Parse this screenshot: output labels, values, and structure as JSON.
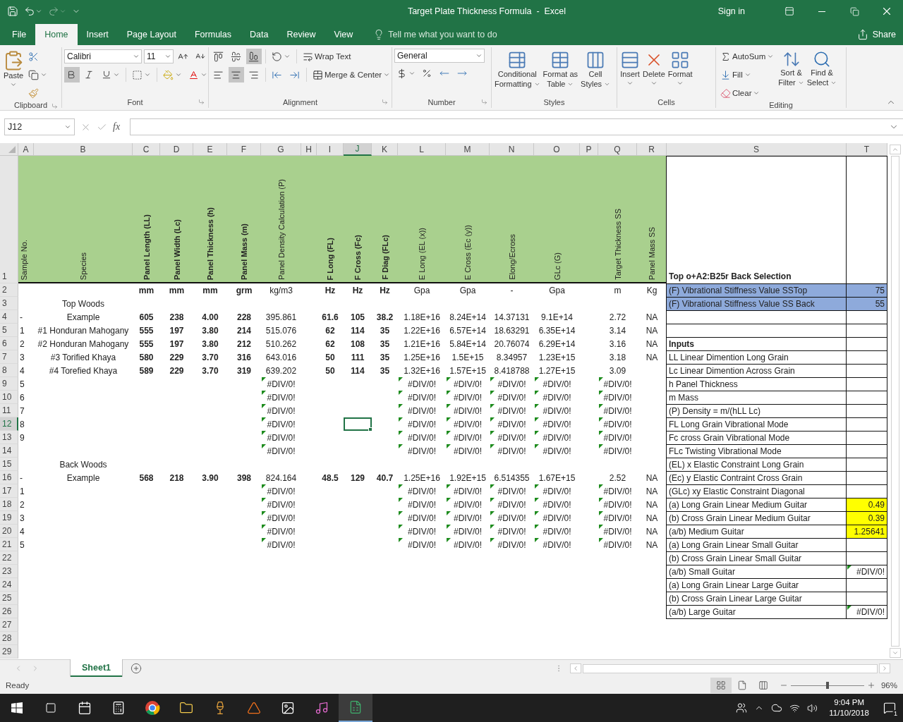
{
  "title_bar": {
    "title": "Target Plate Thickness Formula  -  Excel",
    "sign_in": "Sign in"
  },
  "ribbon_tabs": [
    {
      "label": "File",
      "selected": false
    },
    {
      "label": "Home",
      "selected": true
    },
    {
      "label": "Insert",
      "selected": false
    },
    {
      "label": "Page Layout",
      "selected": false
    },
    {
      "label": "Formulas",
      "selected": false
    },
    {
      "label": "Data",
      "selected": false
    },
    {
      "label": "Review",
      "selected": false
    },
    {
      "label": "View",
      "selected": false
    }
  ],
  "tell_me": "Tell me what you want to do",
  "share": "Share",
  "ribbon": {
    "clipboard": {
      "label": "Clipboard",
      "paste": "Paste"
    },
    "font": {
      "label": "Font",
      "name": "Calibri",
      "size": "11",
      "bold": true,
      "italic": false,
      "underline": false
    },
    "alignment": {
      "label": "Alignment",
      "wrap_text": "Wrap Text",
      "merge_center": "Merge & Center",
      "vertical_align": [
        {
          "selected": false
        },
        {
          "selected": false
        },
        {
          "selected": true
        }
      ],
      "horizontal_align": [
        {
          "selected": false
        },
        {
          "selected": true
        },
        {
          "selected": false
        }
      ]
    },
    "number": {
      "label": "Number",
      "format": "General"
    },
    "styles": {
      "label": "Styles",
      "buttons": [
        {
          "line1": "Conditional",
          "line2": "Formatting"
        },
        {
          "line1": "Format as",
          "line2": "Table"
        },
        {
          "line1": "Cell",
          "line2": "Styles"
        }
      ]
    },
    "cells": {
      "label": "Cells",
      "buttons": [
        "Insert",
        "Delete",
        "Format"
      ]
    },
    "editing": {
      "label": "Editing",
      "autosum": "AutoSum",
      "fill": "Fill",
      "clear": "Clear",
      "sort": {
        "line1": "Sort &",
        "line2": "Filter"
      },
      "find": {
        "line1": "Find &",
        "line2": "Select"
      }
    }
  },
  "formula_bar": {
    "name_box": "J12",
    "function_label": "fx"
  },
  "sheet": {
    "columns": [
      {
        "letter": "A",
        "bold": false,
        "selected": false
      },
      {
        "letter": "B",
        "bold": false,
        "selected": false
      },
      {
        "letter": "C",
        "bold": true,
        "selected": false
      },
      {
        "letter": "D",
        "bold": true,
        "selected": false
      },
      {
        "letter": "E",
        "bold": true,
        "selected": false
      },
      {
        "letter": "F",
        "bold": true,
        "selected": false
      },
      {
        "letter": "G",
        "bold": false,
        "selected": false
      },
      {
        "letter": "H",
        "selected": false
      },
      {
        "letter": "I",
        "bold": true,
        "selected": false
      },
      {
        "letter": "J",
        "bold": true,
        "selected": true
      },
      {
        "letter": "K",
        "bold": true,
        "selected": false
      },
      {
        "letter": "L",
        "bold": false,
        "selected": false
      },
      {
        "letter": "M",
        "bold": false,
        "selected": false
      },
      {
        "letter": "N",
        "bold": false,
        "selected": false
      },
      {
        "letter": "O",
        "bold": false,
        "selected": false
      },
      {
        "letter": "P",
        "selected": false
      },
      {
        "letter": "Q",
        "bold": false,
        "selected": false
      },
      {
        "letter": "R",
        "bold": false,
        "selected": false
      },
      {
        "letter": "S",
        "selected": false
      },
      {
        "letter": "T",
        "selected": false
      }
    ],
    "rows": [
      {
        "number": "1",
        "kind": "header",
        "selected": false,
        "cells": [
          "Sample No.",
          "Species",
          "Panel Length (LL)",
          "Panel Width (Lc)",
          "Panel Thickness (h)",
          "Panel Mass (m)",
          "Panel Density Calculation (P)",
          null,
          "F Long (FL)",
          "F Cross (Fc)",
          "F Diag (FLc)",
          "E Long (EL (x))",
          "E Cross (Ec (y))",
          "Elong/Ecross",
          "GLc (G)",
          null,
          "Target Thickness SS",
          "Panel Mass SS"
        ]
      },
      {
        "number": "2",
        "kind": "data",
        "selected": false,
        "cells": [
          null,
          null,
          "mm",
          "mm",
          "mm",
          "grm",
          "kg/m3",
          null,
          "Hz",
          "Hz",
          "Hz",
          "Gpa",
          "Gpa",
          "-",
          "Gpa",
          null,
          "m",
          "Kg"
        ]
      },
      {
        "number": "3",
        "kind": "data",
        "selected": false,
        "cells": [
          null,
          "Top Woods"
        ]
      },
      {
        "number": "4",
        "kind": "data",
        "selected": false,
        "cells": [
          "-",
          "Example",
          "605",
          "238",
          "4.00",
          "228",
          "395.861",
          null,
          "61.6",
          "105",
          "38.2",
          "1.18E+16",
          "8.24E+14",
          "14.37131",
          "9.1E+14",
          null,
          "2.72",
          "NA"
        ]
      },
      {
        "number": "5",
        "kind": "data",
        "selected": false,
        "cells": [
          "1",
          "#1 Honduran Mahogany",
          "555",
          "197",
          "3.80",
          "214",
          "515.076",
          null,
          "62",
          "114",
          "35",
          "1.22E+16",
          "6.57E+14",
          "18.63291",
          "6.35E+14",
          null,
          "3.14",
          "NA"
        ]
      },
      {
        "number": "6",
        "kind": "data",
        "selected": false,
        "cells": [
          "2",
          "#2 Honduran Mahogany",
          "555",
          "197",
          "3.80",
          "212",
          "510.262",
          null,
          "62",
          "108",
          "35",
          "1.21E+16",
          "5.84E+14",
          "20.76074",
          "6.29E+14",
          null,
          "3.16",
          "NA"
        ]
      },
      {
        "number": "7",
        "kind": "data",
        "selected": false,
        "cells": [
          "3",
          "#3 Torified Khaya",
          "580",
          "229",
          "3.70",
          "316",
          "643.016",
          null,
          "50",
          "111",
          "35",
          "1.25E+16",
          "1.5E+15",
          "8.34957",
          "1.23E+15",
          null,
          "3.18",
          "NA"
        ]
      },
      {
        "number": "8",
        "kind": "data",
        "selected": false,
        "cells": [
          "4",
          "#4 Torefied Khaya",
          "589",
          "229",
          "3.70",
          "319",
          "639.202",
          null,
          "50",
          "114",
          "35",
          "1.32E+16",
          "1.57E+15",
          "8.418788",
          "1.27E+15",
          null,
          "3.09"
        ]
      },
      {
        "number": "9",
        "kind": "data",
        "selected": false,
        "cells": [
          "5",
          null,
          null,
          null,
          null,
          null,
          {
            "text": "#DIV/0!",
            "flagged": true
          },
          null,
          null,
          null,
          null,
          {
            "text": "#DIV/0!",
            "flagged": true
          },
          {
            "text": "#DIV/0!",
            "flagged": true
          },
          {
            "text": "#DIV/0!",
            "flagged": true
          },
          {
            "text": "#DIV/0!",
            "flagged": true
          },
          null,
          {
            "text": "#DIV/0!",
            "flagged": true
          }
        ]
      },
      {
        "number": "10",
        "kind": "data",
        "selected": false,
        "cells": [
          "6",
          null,
          null,
          null,
          null,
          null,
          {
            "text": "#DIV/0!",
            "flagged": true
          },
          null,
          null,
          null,
          null,
          {
            "text": "#DIV/0!",
            "flagged": true
          },
          {
            "text": "#DIV/0!",
            "flagged": true
          },
          {
            "text": "#DIV/0!",
            "flagged": true
          },
          {
            "text": "#DIV/0!",
            "flagged": true
          },
          null,
          {
            "text": "#DIV/0!",
            "flagged": true
          }
        ]
      },
      {
        "number": "11",
        "kind": "data",
        "selected": false,
        "cells": [
          "7",
          null,
          null,
          null,
          null,
          null,
          {
            "text": "#DIV/0!",
            "flagged": true
          },
          null,
          null,
          null,
          null,
          {
            "text": "#DIV/0!",
            "flagged": true
          },
          {
            "text": "#DIV/0!",
            "flagged": true
          },
          {
            "text": "#DIV/0!",
            "flagged": true
          },
          {
            "text": "#DIV/0!",
            "flagged": true
          },
          null,
          {
            "text": "#DIV/0!",
            "flagged": true
          }
        ]
      },
      {
        "number": "12",
        "kind": "data",
        "selected": true,
        "cells": [
          "8",
          null,
          null,
          null,
          null,
          null,
          {
            "text": "#DIV/0!",
            "flagged": true
          },
          null,
          null,
          null,
          null,
          {
            "text": "#DIV/0!",
            "flagged": true
          },
          {
            "text": "#DIV/0!",
            "flagged": true
          },
          {
            "text": "#DIV/0!",
            "flagged": true
          },
          {
            "text": "#DIV/0!",
            "flagged": true
          },
          null,
          {
            "text": "#DIV/0!",
            "flagged": true
          }
        ]
      },
      {
        "number": "13",
        "kind": "data",
        "selected": false,
        "cells": [
          "9",
          null,
          null,
          null,
          null,
          null,
          {
            "text": "#DIV/0!",
            "flagged": true
          },
          null,
          null,
          null,
          null,
          {
            "text": "#DIV/0!",
            "flagged": true
          },
          {
            "text": "#DIV/0!",
            "flagged": true
          },
          {
            "text": "#DIV/0!",
            "flagged": true
          },
          {
            "text": "#DIV/0!",
            "flagged": true
          },
          null,
          {
            "text": "#DIV/0!",
            "flagged": true
          }
        ]
      },
      {
        "number": "14",
        "kind": "data",
        "selected": false,
        "cells": [
          null,
          null,
          null,
          null,
          null,
          null,
          {
            "text": "#DIV/0!",
            "flagged": true
          },
          null,
          null,
          null,
          null,
          {
            "text": "#DIV/0!",
            "flagged": true
          },
          {
            "text": "#DIV/0!",
            "flagged": true
          },
          {
            "text": "#DIV/0!",
            "flagged": true
          },
          {
            "text": "#DIV/0!",
            "flagged": true
          },
          null,
          {
            "text": "#DIV/0!",
            "flagged": true
          }
        ]
      },
      {
        "number": "15",
        "kind": "data",
        "selected": false,
        "cells": [
          null,
          "Back Woods"
        ]
      },
      {
        "number": "16",
        "kind": "data",
        "selected": false,
        "cells": [
          "-",
          "Example",
          "568",
          "218",
          "3.90",
          "398",
          "824.164",
          null,
          "48.5",
          "129",
          "40.7",
          "1.25E+16",
          "1.92E+15",
          "6.514355",
          "1.67E+15",
          null,
          "2.52",
          "NA"
        ]
      },
      {
        "number": "17",
        "kind": "data",
        "selected": false,
        "cells": [
          "1",
          null,
          null,
          null,
          null,
          null,
          {
            "text": "#DIV/0!",
            "flagged": true
          },
          null,
          null,
          null,
          null,
          {
            "text": "#DIV/0!",
            "flagged": true
          },
          {
            "text": "#DIV/0!",
            "flagged": true
          },
          {
            "text": "#DIV/0!",
            "flagged": true
          },
          {
            "text": "#DIV/0!",
            "flagged": true
          },
          null,
          {
            "text": "#DIV/0!",
            "flagged": true
          },
          "NA"
        ]
      },
      {
        "number": "18",
        "kind": "data",
        "selected": false,
        "cells": [
          "2",
          null,
          null,
          null,
          null,
          null,
          {
            "text": "#DIV/0!",
            "flagged": true
          },
          null,
          null,
          null,
          null,
          {
            "text": "#DIV/0!",
            "flagged": true
          },
          {
            "text": "#DIV/0!",
            "flagged": true
          },
          {
            "text": "#DIV/0!",
            "flagged": true
          },
          {
            "text": "#DIV/0!",
            "flagged": true
          },
          null,
          {
            "text": "#DIV/0!",
            "flagged": true
          },
          "NA"
        ]
      },
      {
        "number": "19",
        "kind": "data",
        "selected": false,
        "cells": [
          "3",
          null,
          null,
          null,
          null,
          null,
          {
            "text": "#DIV/0!",
            "flagged": true
          },
          null,
          null,
          null,
          null,
          {
            "text": "#DIV/0!",
            "flagged": true
          },
          {
            "text": "#DIV/0!",
            "flagged": true
          },
          {
            "text": "#DIV/0!",
            "flagged": true
          },
          {
            "text": "#DIV/0!",
            "flagged": true
          },
          null,
          {
            "text": "#DIV/0!",
            "flagged": true
          },
          "NA"
        ]
      },
      {
        "number": "20",
        "kind": "data",
        "selected": false,
        "cells": [
          "4",
          null,
          null,
          null,
          null,
          null,
          {
            "text": "#DIV/0!",
            "flagged": true
          },
          null,
          null,
          null,
          null,
          {
            "text": "#DIV/0!",
            "flagged": true
          },
          {
            "text": "#DIV/0!",
            "flagged": true
          },
          {
            "text": "#DIV/0!",
            "flagged": true
          },
          {
            "text": "#DIV/0!",
            "flagged": true
          },
          null,
          {
            "text": "#DIV/0!",
            "flagged": true
          },
          "NA"
        ]
      },
      {
        "number": "21",
        "kind": "data",
        "selected": false,
        "cells": [
          "5",
          null,
          null,
          null,
          null,
          null,
          {
            "text": "#DIV/0!",
            "flagged": true
          },
          null,
          null,
          null,
          null,
          {
            "text": "#DIV/0!",
            "flagged": true
          },
          {
            "text": "#DIV/0!",
            "flagged": true
          },
          {
            "text": "#DIV/0!",
            "flagged": true
          },
          {
            "text": "#DIV/0!",
            "flagged": true
          },
          null,
          {
            "text": "#DIV/0!",
            "flagged": true
          },
          "NA"
        ]
      },
      {
        "number": "22",
        "kind": "data",
        "selected": false
      },
      {
        "number": "23",
        "kind": "data",
        "selected": false
      },
      {
        "number": "24",
        "kind": "data",
        "selected": false
      },
      {
        "number": "25",
        "kind": "data",
        "selected": false
      },
      {
        "number": "26",
        "kind": "data",
        "selected": false
      },
      {
        "number": "27",
        "kind": "data",
        "selected": false
      },
      {
        "number": "28",
        "kind": "data",
        "selected": false
      },
      {
        "number": "29",
        "kind": "data",
        "selected": false
      }
    ]
  },
  "side_table": {
    "title": "Top o+A2:B25r Back Selection",
    "rows": [
      {
        "kind": "entry",
        "label": {
          "text": "(F) Vibrational Stiffness Value SSTop",
          "color": "#8eaadb"
        },
        "value": {
          "text": "75",
          "color": "#8eaadb"
        }
      },
      {
        "kind": "entry",
        "label": {
          "text": "(F) Vibrational Stiffness Value SS Back",
          "color": "#8eaadb"
        },
        "value": {
          "text": "55",
          "color": "#8eaadb"
        }
      },
      {
        "kind": "entry"
      },
      {
        "kind": "entry"
      },
      {
        "kind": "heading",
        "label": "Inputs"
      },
      {
        "kind": "entry",
        "label": "LL Linear Dimention Long Grain"
      },
      {
        "kind": "entry",
        "label": "Lc Linear Dimention Across Grain"
      },
      {
        "kind": "entry",
        "label": "h Panel Thickness"
      },
      {
        "kind": "entry",
        "label": "m Mass"
      },
      {
        "kind": "entry",
        "label": "(P) Density = m/(hLL Lc)"
      },
      {
        "kind": "entry",
        "label": "FL Long Grain Vibrational Mode"
      },
      {
        "kind": "entry",
        "label": "Fc cross Grain Vibrational Mode"
      },
      {
        "kind": "entry",
        "label": "FLc Twisting Vibrational Mode"
      },
      {
        "kind": "entry",
        "label": "(EL) x Elastic  Constraint Long Grain"
      },
      {
        "kind": "entry",
        "label": "(Ec)  y Elastic Contraint Cross Grain"
      },
      {
        "kind": "entry",
        "label": "(GLc)  xy Elastic Constraint Diagonal"
      },
      {
        "kind": "entry",
        "label": "(a) Long Grain Linear Medium Guitar",
        "value": {
          "text": "0.49",
          "color": "#ffff00"
        }
      },
      {
        "kind": "entry",
        "label": "(b) Cross Grain Linear Medium Guitar",
        "value": {
          "text": "0.39",
          "color": "#ffff00"
        }
      },
      {
        "kind": "entry",
        "label": "(a/b) Medium Guitar",
        "value": {
          "text": "1.25641",
          "color": "#ffff00"
        }
      },
      {
        "kind": "entry",
        "label": "(a) Long Grain Linear Small Guitar"
      },
      {
        "kind": "entry",
        "label": "(b) Cross Grain Linear Small Guitar"
      },
      {
        "kind": "entry",
        "label": "(a/b) Small Guitar",
        "value": {
          "text": "#DIV/0!",
          "flagged": true
        }
      },
      {
        "kind": "entry",
        "label": "(a) Long Grain Linear Large Guitar"
      },
      {
        "kind": "entry",
        "label": "(b) Cross Grain Linear Large Guitar"
      },
      {
        "kind": "entry",
        "label": "(a/b) Large Guitar",
        "value": {
          "text": "#DIV/0!",
          "flagged": true
        }
      }
    ]
  },
  "sheet_tabs": [
    {
      "label": "Sheet1",
      "selected": true
    }
  ],
  "status_bar": {
    "status": "Ready",
    "zoom": {
      "level": 0.5,
      "reading": "96%"
    }
  },
  "taskbar": {
    "time": "9:04 PM",
    "date": "11/10/2018",
    "notifications": "1"
  }
}
